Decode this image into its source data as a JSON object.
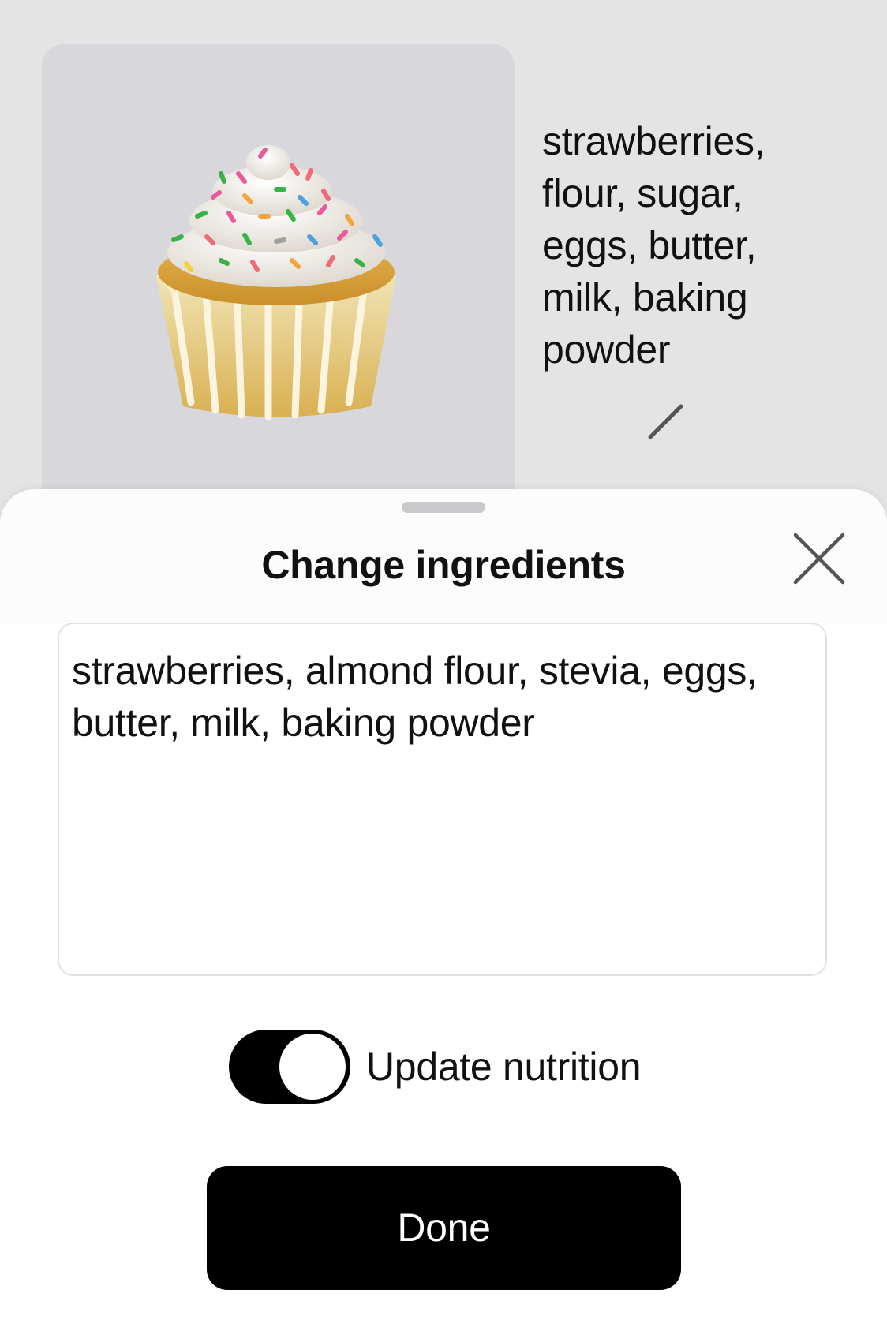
{
  "recipe": {
    "image_icon": "cupcake-emoji",
    "ingredients_text": "strawberries, flour, sugar, eggs, butter, milk, baking powder",
    "edit_icon": "pencil-icon"
  },
  "sheet": {
    "title": "Change ingredients",
    "close_icon": "close-icon",
    "ingredients_value": "strawberries, almond flour, stevia, eggs, butter, milk, baking powder",
    "toggle": {
      "label": "Update nutrition",
      "on": true
    },
    "done_label": "Done"
  },
  "colors": {
    "backdrop": "#e4e4e4",
    "tile": "#d8d8dc",
    "accent": "#000000",
    "sheet": "#ffffff"
  }
}
